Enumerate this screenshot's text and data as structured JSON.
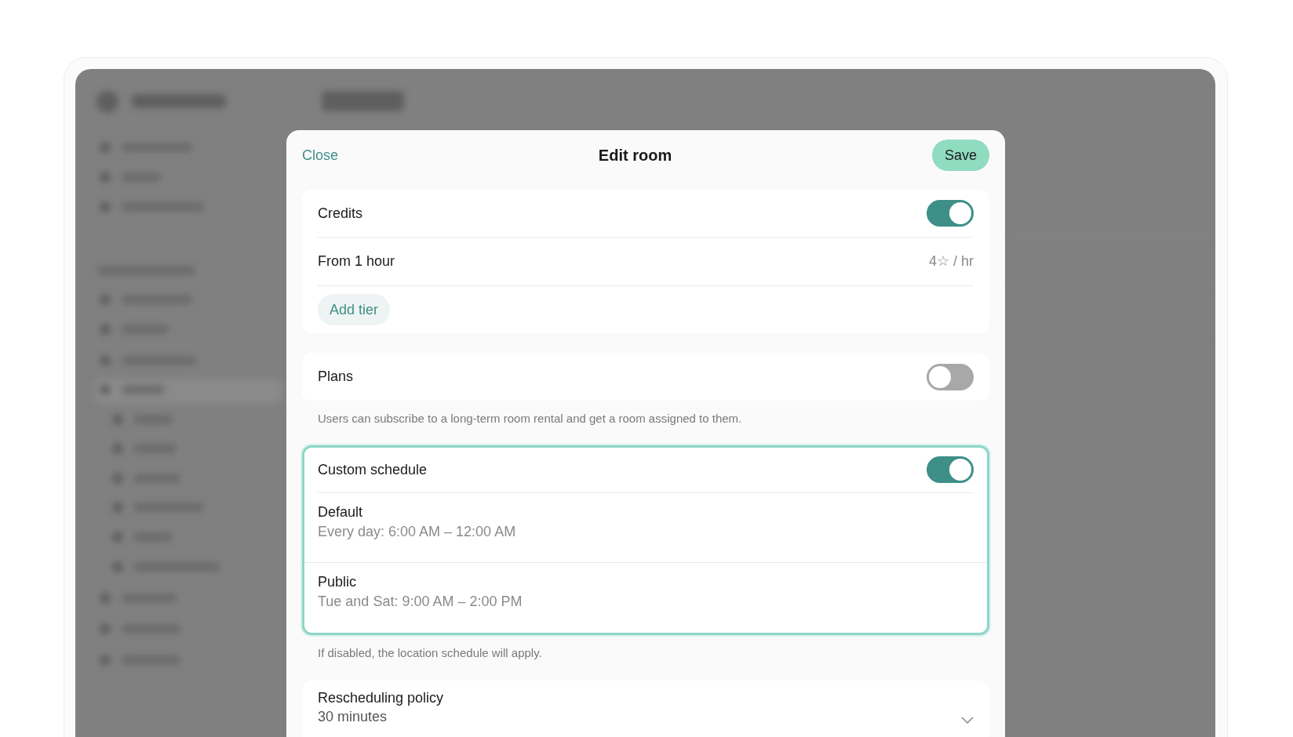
{
  "modal": {
    "title": "Edit room",
    "close": "Close",
    "save": "Save"
  },
  "credits": {
    "label": "Credits",
    "on": true,
    "tiers": [
      {
        "label": "From 1 hour",
        "price": "4☆ / hr"
      }
    ],
    "add_button": "Add tier"
  },
  "plans": {
    "label": "Plans",
    "on": false,
    "hint": "Users can subscribe to a long-term room rental and get a room assigned to them."
  },
  "custom_schedule": {
    "label": "Custom schedule",
    "on": true,
    "focused": true,
    "schedules": [
      {
        "name": "Default",
        "hours": "Every day: 6:00 AM – 12:00 AM"
      },
      {
        "name": "Public",
        "hours": "Tue and Sat: 9:00 AM – 2:00 PM"
      }
    ],
    "hint": "If disabled, the location schedule will apply."
  },
  "rescheduling": {
    "label": "Rescheduling policy",
    "value": "30 minutes"
  }
}
